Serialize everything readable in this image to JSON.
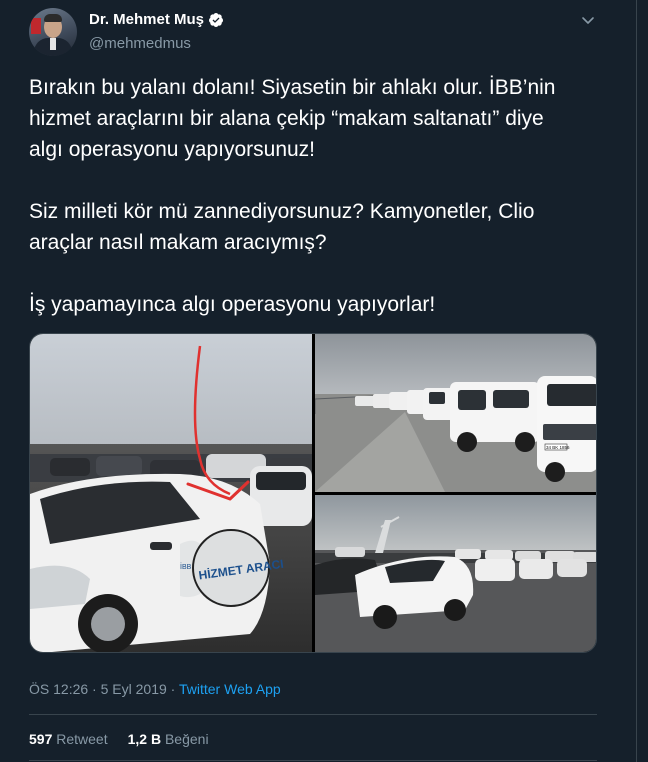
{
  "user": {
    "display_name": "Dr. Mehmet Muş",
    "handle": "@mehmedmus",
    "avatar_icon": "profile-photo",
    "verified_icon": "verified-badge-icon"
  },
  "tweet": {
    "lines_paragraph1": [
      "Bırakın bu yalanı dolanı! Siyasetin bir ahlakı olur. İBB’nin",
      "hizmet araçlarını bir alana çekip “makam saltanatı” diye",
      "algı operasyonu yapıyorsunuz!"
    ],
    "lines_paragraph2": [
      "Siz milleti kör mü zannediyorsunuz? Kamyonetler, Clio",
      "araçlar nasıl makam aracıymış?"
    ],
    "lines_paragraph3": [
      "İş yapamayınca algı operasyonu yapıyorlar!"
    ]
  },
  "media": {
    "left_car_text": "HİZMET ARACI",
    "left_car_text_small": "İBB",
    "tr_plate": "34 BK 1856"
  },
  "meta": {
    "time": "ÖS 12:26",
    "sep1": " · ",
    "date": "5 Eyl 2019",
    "sep2": " · ",
    "source": "Twitter Web App"
  },
  "stats": {
    "retweets_count": "597",
    "retweets_label": "Retweet",
    "likes_count": "1,2 B",
    "likes_label": "Beğeni"
  },
  "colors": {
    "background": "#15202b",
    "text_primary": "#ffffff",
    "text_secondary": "#8899a6",
    "link": "#1da1f2",
    "divider": "#38444d",
    "annotation_arrow": "#e0312f"
  }
}
